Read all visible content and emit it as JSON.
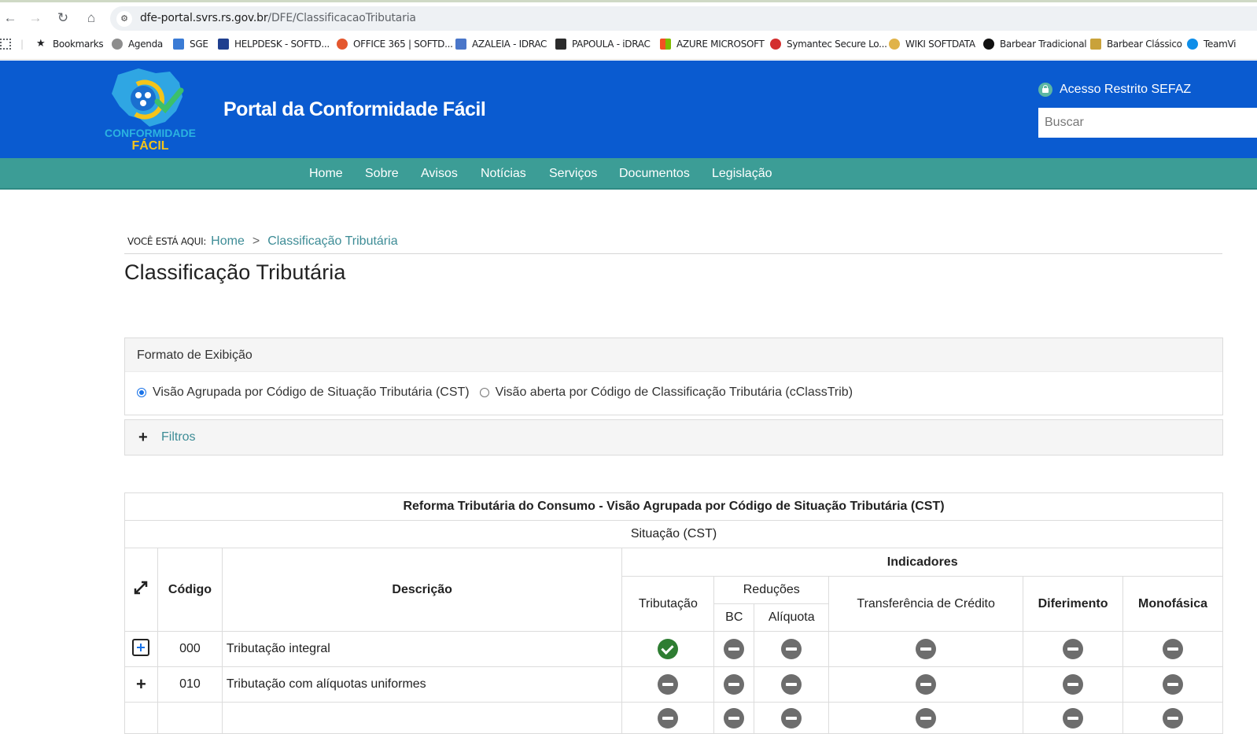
{
  "browser": {
    "url_domain": "dfe-portal.svrs.rs.gov.br",
    "url_path": "/DFE/ClassificacaoTributaria",
    "bookmarks": [
      "Bookmarks",
      "Agenda",
      "SGE",
      "HELPDESK - SOFTD...",
      "OFFICE 365 | SOFTD...",
      "AZALEIA - IDRAC",
      "PAPOULA - iDRAC",
      "AZURE MICROSOFT",
      "Symantec Secure Lo...",
      "WIKI SOFTDATA",
      "Barbear Tradicional",
      "Barbear Clássico",
      "TeamVi"
    ]
  },
  "header": {
    "logo_line1": "CONFORMIDADE",
    "logo_line2": "FÁCIL",
    "title": "Portal da Conformidade Fácil",
    "restricted_access": "Acesso Restrito SEFAZ",
    "search_placeholder": "Buscar"
  },
  "nav": [
    "Home",
    "Sobre",
    "Avisos",
    "Notícias",
    "Serviços",
    "Documentos",
    "Legislação"
  ],
  "breadcrumb": {
    "label": "VOCÊ ESTÁ AQUI:",
    "home": "Home",
    "separator": ">",
    "current": "Classificação Tributária"
  },
  "page_title": "Classificação Tributária",
  "format": {
    "heading": "Formato de Exibição",
    "option1": "Visão Agrupada por Código de Situação Tributária (CST)",
    "option2": "Visão aberta por Código de Classificação Tributária (cClassTrib)",
    "selected": 1
  },
  "filters_label": "Filtros",
  "table": {
    "caption": "Reforma Tributária do Consumo - Visão Agrupada por Código de Situação Tributária (CST)",
    "group": "Situação (CST)",
    "col_code": "Código",
    "col_desc": "Descrição",
    "indicators": "Indicadores",
    "col_tributacao": "Tributação",
    "col_reducoes": "Reduções",
    "col_bc": "BC",
    "col_aliquota": "Alíquota",
    "col_transferencia": "Transferência de Crédito",
    "col_diferimento": "Diferimento",
    "col_monofasica": "Monofásica",
    "rows": [
      {
        "code": "000",
        "desc": "Tributação integral",
        "tributacao": true,
        "bc": false,
        "aliquota": false,
        "transferencia": false,
        "diferimento": false,
        "monofasica": false
      },
      {
        "code": "010",
        "desc": "Tributação com alíquotas uniformes",
        "tributacao": false,
        "bc": false,
        "aliquota": false,
        "transferencia": false,
        "diferimento": false,
        "monofasica": false
      }
    ]
  },
  "colors": {
    "header_blue": "#0a5bd0",
    "nav_teal": "#3c9d96",
    "link_teal": "#3d8c96",
    "check_green": "#2e7d32"
  }
}
